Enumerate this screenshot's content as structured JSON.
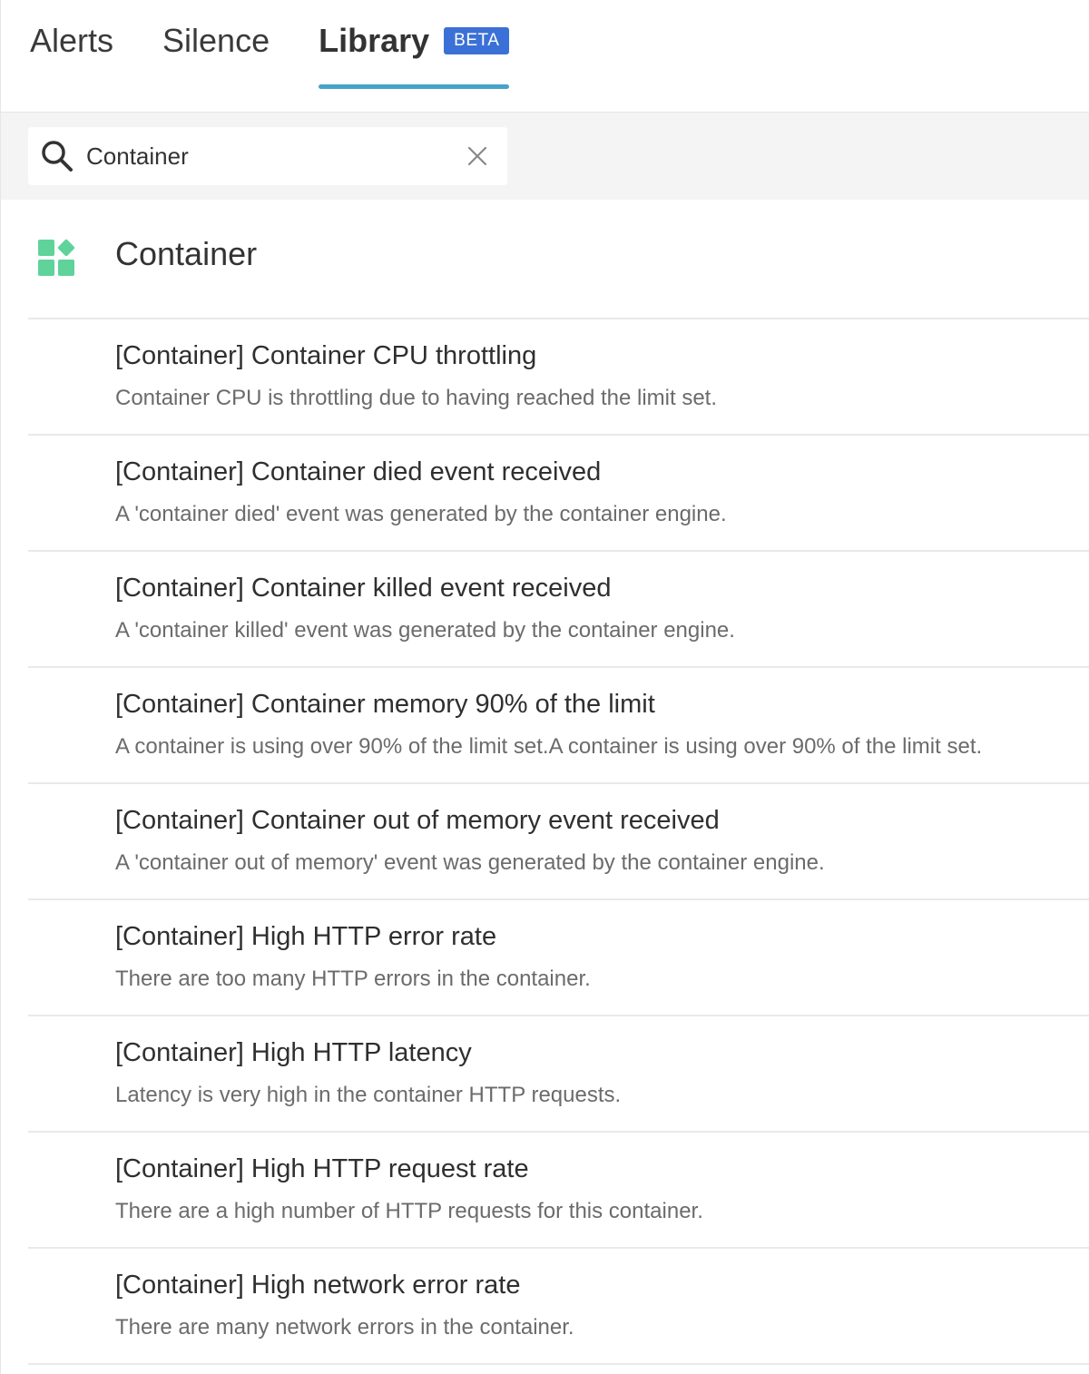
{
  "tabs": [
    {
      "label": "Alerts"
    },
    {
      "label": "Silence"
    },
    {
      "label": "Library",
      "badge": "BETA",
      "active": true
    }
  ],
  "search": {
    "value": "Container",
    "placeholder": "Search"
  },
  "category": {
    "title": "Container",
    "icon": "container-blocks-icon",
    "icon_color": "#5fd39a"
  },
  "colors": {
    "tab_underline": "#46a3c8",
    "badge_bg": "#3b71d6"
  },
  "items": [
    {
      "title": "[Container] Container CPU throttling",
      "description": "Container CPU is throttling due to having reached the limit set."
    },
    {
      "title": "[Container] Container died event received",
      "description": "A 'container died' event was generated by the container engine."
    },
    {
      "title": "[Container] Container killed event received",
      "description": "A 'container killed' event was generated by the container engine."
    },
    {
      "title": "[Container] Container memory 90% of the limit",
      "description": "A container is using over 90% of the limit set.A container is using over 90% of the limit set."
    },
    {
      "title": "[Container] Container out of memory event received",
      "description": "A 'container out of memory' event was generated by the container engine."
    },
    {
      "title": "[Container] High HTTP error rate",
      "description": "There are too many HTTP errors in the container."
    },
    {
      "title": "[Container] High HTTP latency",
      "description": "Latency is very high in the container HTTP requests."
    },
    {
      "title": "[Container] High HTTP request rate",
      "description": "There are a high number of HTTP requests for this container."
    },
    {
      "title": "[Container] High network error rate",
      "description": "There are many network errors in the container."
    }
  ]
}
